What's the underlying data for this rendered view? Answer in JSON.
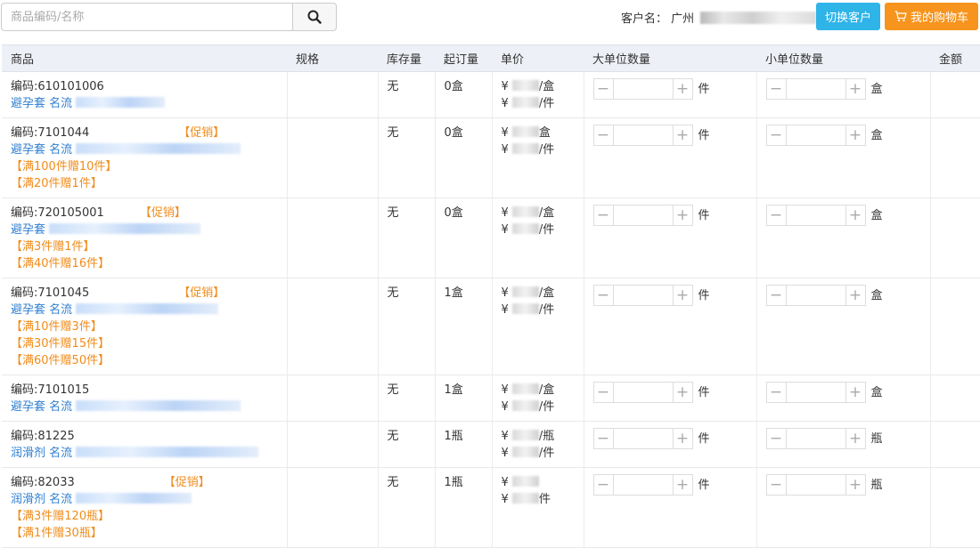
{
  "search": {
    "placeholder": "商品编码/名称",
    "value": ""
  },
  "customer": {
    "label": "客户名：",
    "name_prefix": "广州"
  },
  "buttons": {
    "switch_customer": "切换客户",
    "my_cart": "我的购物车"
  },
  "table": {
    "headers": [
      "商品",
      "规格",
      "库存量",
      "起订量",
      "单价",
      "大单位数量",
      "小单位数量",
      "金额"
    ],
    "rows": [
      {
        "code": "编码:610101006",
        "promo": "",
        "category": "避孕套",
        "name_label": "名流",
        "blur_w": 100,
        "gifts": [],
        "stock": "无",
        "moq": "0盒",
        "price1_unit": "/盒",
        "price2_unit": "/件",
        "big_unit": "件",
        "small_unit": "盒",
        "big_qty": "",
        "small_qty": ""
      },
      {
        "code": "编码:7101044",
        "promo": "【促销】",
        "category": "避孕套",
        "name_label": "名流",
        "blur_w": 185,
        "gifts": [
          "【满100件赠10件】",
          "【满20件赠1件】"
        ],
        "stock": "无",
        "moq": "0盒",
        "price1_unit": "盒",
        "price2_unit": "/件",
        "big_unit": "件",
        "small_unit": "盒",
        "big_qty": "",
        "small_qty": ""
      },
      {
        "code": "编码:720105001",
        "promo": "【促销】",
        "category": "避孕套",
        "name_label": "",
        "blur_w": 170,
        "gifts": [
          "【满3件赠1件】",
          "【满40件赠16件】"
        ],
        "stock": "无",
        "moq": "0盒",
        "price1_unit": "/盒",
        "price2_unit": "/件",
        "big_unit": "件",
        "small_unit": "盒",
        "big_qty": "",
        "small_qty": ""
      },
      {
        "code": "编码:7101045",
        "promo": "【促销】",
        "category": "避孕套",
        "name_label": "名流",
        "blur_w": 160,
        "gifts": [
          "【满10件赠3件】",
          "【满30件赠15件】",
          "【满60件赠50件】"
        ],
        "stock": "无",
        "moq": "1盒",
        "price1_unit": "/盒",
        "price2_unit": "/件",
        "big_unit": "件",
        "small_unit": "盒",
        "big_qty": "",
        "small_qty": ""
      },
      {
        "code": "编码:7101015",
        "promo": "",
        "category": "避孕套",
        "name_label": "名流",
        "blur_w": 185,
        "gifts": [],
        "stock": "无",
        "moq": "1盒",
        "price1_unit": "/盒",
        "price2_unit": "/件",
        "big_unit": "件",
        "small_unit": "盒",
        "big_qty": "",
        "small_qty": ""
      },
      {
        "code": "编码:81225",
        "promo": "",
        "category": "润滑剂",
        "name_label": "名流",
        "blur_w": 205,
        "gifts": [],
        "stock": "无",
        "moq": "1瓶",
        "price1_unit": "/瓶",
        "price2_unit": "/件",
        "big_unit": "件",
        "small_unit": "瓶",
        "big_qty": "",
        "small_qty": ""
      },
      {
        "code": "编码:82033",
        "promo": "【促销】",
        "category": "润滑剂",
        "name_label": "名流",
        "blur_w": 130,
        "gifts": [
          "【满3件赠120瓶】",
          "【满1件赠30瓶】"
        ],
        "stock": "无",
        "moq": "1瓶",
        "price1_unit": "",
        "price2_unit": "件",
        "big_unit": "件",
        "small_unit": "瓶",
        "big_qty": "",
        "small_qty": ""
      }
    ]
  },
  "symbols": {
    "currency": "¥",
    "minus": "−",
    "plus": "+"
  },
  "colors": {
    "switch_button": "#2fb4e8",
    "cart_button": "#f7941d",
    "promo": "#f08c1b",
    "link": "#2f7fd1",
    "header_bg": "#eef0f7"
  },
  "icons": {
    "search": "search-icon",
    "cart": "cart-icon"
  }
}
